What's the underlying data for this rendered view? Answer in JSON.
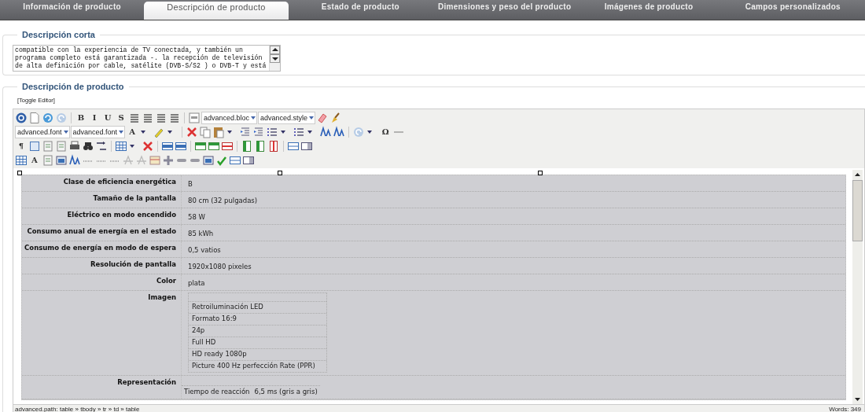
{
  "tabs": [
    {
      "label": "Información de producto",
      "selected": false
    },
    {
      "label": "Descripción de producto",
      "selected": true
    },
    {
      "label": "Estado de producto",
      "selected": false
    },
    {
      "label": "Dimensiones y peso del producto",
      "selected": false
    },
    {
      "label": "Imágenes de producto",
      "selected": false
    },
    {
      "label": "Campos personalizados",
      "selected": false
    }
  ],
  "short_description": {
    "legend": "Descripción corta",
    "lines": [
      "compatible con la experiencia de TV conectada, y también un",
      "programa completo está garantizada -. la recepción de televisión",
      "de alta definición por cable, satélite (DVB-S/S2 ) o DVB-T y está"
    ]
  },
  "product_description": {
    "legend": "Descripción de producto",
    "toggle_link": "[Toggle Editor]",
    "toolbar": {
      "glyphs": [
        "B",
        "I",
        "U",
        "S",
        "A",
        "Ω",
        "¶",
        "A"
      ],
      "selects": [
        "advanced.bloc",
        "advanced.style",
        "advanced.font",
        "advanced.font"
      ]
    },
    "rows": [
      {
        "kind": "text",
        "label": "Clase de eficiencia energética",
        "value": "B"
      },
      {
        "kind": "text",
        "label": "Tamaño de la pantalla",
        "value": "80 cm (32 pulgadas)"
      },
      {
        "kind": "text",
        "label": "Eléctrico en modo encendido",
        "value": "58 W"
      },
      {
        "kind": "text",
        "label": "Consumo anual de energía en el estado",
        "value": "85 kWh"
      },
      {
        "kind": "text",
        "label": "Consumo de energía en modo de espera",
        "value": "0,5 vatios"
      },
      {
        "kind": "text",
        "label": "Resolución de pantalla",
        "value": "1920x1080 pixeles"
      },
      {
        "kind": "text",
        "label": "Color",
        "value": "plata"
      },
      {
        "kind": "list",
        "label": "Imagen",
        "values": [
          "Retroiluminación LED",
          "Formato 16:9",
          "24p",
          "Full HD",
          "HD ready 1080p",
          "Picture 400 Hz perfección Rate (PPR)"
        ]
      },
      {
        "kind": "pair",
        "label": "Representación",
        "key": "Tiempo de reacción",
        "value": "6,5 ms (gris a gris)"
      }
    ],
    "path": "advanced.path: table » tbody » tr » td » table",
    "words": "Words: 349"
  }
}
